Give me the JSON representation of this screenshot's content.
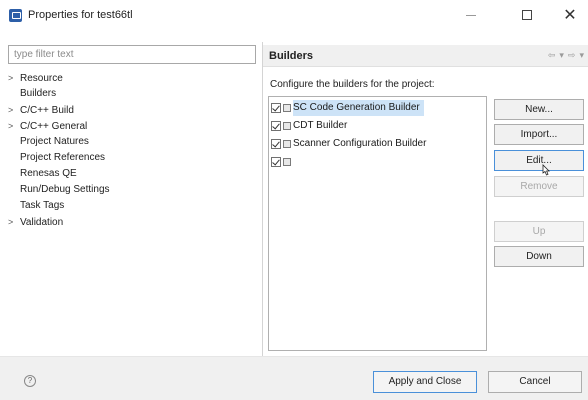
{
  "window": {
    "title": "Properties for test66tl",
    "app_icon": "properties-icon",
    "minimize_icon": "minimize-icon",
    "maximize_icon": "maximize-icon",
    "close_glyph": "✕"
  },
  "filter": {
    "placeholder": "type filter text"
  },
  "tree": {
    "items": [
      {
        "label": "Resource",
        "expandable": true
      },
      {
        "label": "Builders",
        "expandable": false,
        "selected": true
      },
      {
        "label": "C/C++ Build",
        "expandable": true
      },
      {
        "label": "C/C++ General",
        "expandable": true
      },
      {
        "label": "Project Natures",
        "expandable": false
      },
      {
        "label": "Project References",
        "expandable": false
      },
      {
        "label": "Renesas QE",
        "expandable": false
      },
      {
        "label": "Run/Debug Settings",
        "expandable": false
      },
      {
        "label": "Task Tags",
        "expandable": false
      },
      {
        "label": "Validation",
        "expandable": true
      }
    ],
    "chevron": ">"
  },
  "page": {
    "title": "Builders",
    "description": "Configure the builders for the project:",
    "nav_glyphs": {
      "back": "⇦",
      "menu": "▾",
      "forward": "⇨",
      "menu2": "▾"
    }
  },
  "builders": [
    {
      "label": "SC Code Generation Builder",
      "checked": true,
      "selected": true
    },
    {
      "label": "CDT Builder",
      "checked": true,
      "selected": false
    },
    {
      "label": "Scanner Configuration Builder",
      "checked": true,
      "selected": false
    },
    {
      "label": "",
      "checked": true,
      "selected": false
    }
  ],
  "buttons": {
    "new": "New...",
    "import": "Import...",
    "edit": "Edit...",
    "remove": "Remove",
    "up": "Up",
    "down": "Down",
    "apply_close": "Apply and Close",
    "cancel": "Cancel",
    "help": "?"
  },
  "colors": {
    "selection": "#cde3f7",
    "focus": "#4a90d9",
    "disabled_text": "#a8a8a8"
  }
}
